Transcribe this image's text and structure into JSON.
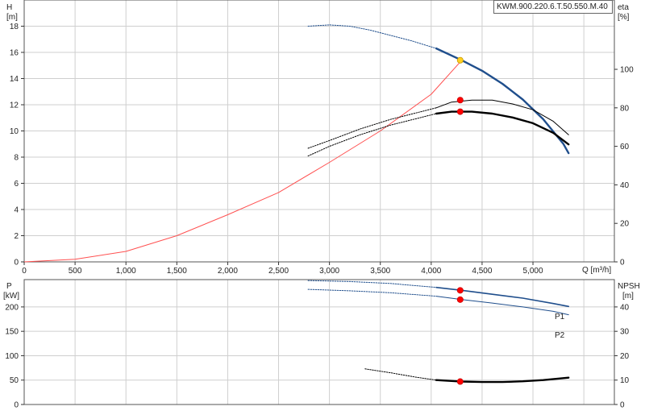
{
  "model": "KWM.900.220.6.T.50.550.M.40",
  "colors": {
    "curve_blue": "#1f4e8c",
    "system_red": "#ff5050",
    "black": "#000000",
    "op_point": "#ff0000",
    "op_yellow": "#ffd020"
  },
  "chart_data": [
    {
      "type": "line",
      "panel": "head_efficiency",
      "xlabel": "Q [m³/h]",
      "left_axis": {
        "label_top": "H",
        "label_unit": "[m]",
        "ticks": [
          "0",
          "2",
          "4",
          "6",
          "8",
          "10",
          "12",
          "14",
          "16",
          "18"
        ],
        "ylim": [
          0,
          20
        ]
      },
      "right_axis": {
        "label_top": "eta",
        "label_unit": "[%]",
        "ticks": [
          "0",
          "20",
          "40",
          "60",
          "80",
          "100"
        ],
        "ylim": [
          0,
          136
        ]
      },
      "x_ticks": [
        "0",
        "500",
        "1,000",
        "1,500",
        "2,000",
        "2,500",
        "3,000",
        "3,500",
        "4,000",
        "4,500",
        "5,000"
      ],
      "xlim": [
        0,
        5800
      ],
      "grid": true,
      "series": [
        {
          "id": "head_curve_dotted",
          "axis": "left",
          "style": "dotted",
          "color": "#1f4e8c",
          "x": [
            2790,
            3000,
            3200,
            3400,
            3600,
            3800,
            4050
          ],
          "y": [
            18.0,
            18.1,
            18.0,
            17.7,
            17.3,
            16.9,
            16.3
          ]
        },
        {
          "id": "head_curve",
          "axis": "left",
          "style": "solid-thick",
          "color": "#1f4e8c",
          "x": [
            4050,
            4300,
            4500,
            4700,
            4900,
            5100,
            5300,
            5350
          ],
          "y": [
            16.3,
            15.4,
            14.6,
            13.6,
            12.4,
            10.9,
            9.0,
            8.3
          ]
        },
        {
          "id": "system_curve",
          "axis": "left",
          "style": "solid-thin",
          "color": "#ff5050",
          "x": [
            0,
            500,
            1000,
            1500,
            2000,
            2500,
            3000,
            3500,
            4000,
            4300
          ],
          "y": [
            0,
            0.2,
            0.8,
            2.0,
            3.6,
            5.3,
            7.6,
            10.0,
            12.8,
            15.4
          ]
        },
        {
          "id": "eta_upper_dotted",
          "axis": "right",
          "style": "dotted",
          "color": "#000000",
          "x": [
            2790,
            3000,
            3300,
            3600,
            3900,
            4050
          ],
          "y": [
            59,
            63,
            69,
            74,
            78,
            80
          ]
        },
        {
          "id": "eta_upper",
          "axis": "right",
          "style": "solid-thin",
          "color": "#000000",
          "x": [
            4050,
            4200,
            4400,
            4600,
            4800,
            5000,
            5200,
            5350
          ],
          "y": [
            80,
            83,
            84,
            84,
            82,
            79,
            73,
            66
          ]
        },
        {
          "id": "eta_lower_dotted",
          "axis": "right",
          "style": "dotted",
          "color": "#000000",
          "x": [
            2790,
            3000,
            3300,
            3600,
            3900,
            4050
          ],
          "y": [
            55,
            60,
            66,
            71,
            75,
            77
          ]
        },
        {
          "id": "eta_lower",
          "axis": "right",
          "style": "solid-thick",
          "color": "#000000",
          "x": [
            4050,
            4200,
            4400,
            4600,
            4800,
            5000,
            5200,
            5350
          ],
          "y": [
            77,
            78,
            78,
            77,
            75,
            72,
            67,
            61
          ]
        }
      ],
      "points": [
        {
          "x": 4285,
          "y": 15.4,
          "axis": "left",
          "color": "#ffd020"
        },
        {
          "x": 4285,
          "y": 84,
          "axis": "right",
          "color": "#ff0000"
        },
        {
          "x": 4285,
          "y": 78,
          "axis": "right",
          "color": "#ff0000"
        }
      ]
    },
    {
      "type": "line",
      "panel": "power_npsh",
      "left_axis": {
        "label_top": "P",
        "label_unit": "[kW]",
        "ticks": [
          "0",
          "50",
          "100",
          "150",
          "200"
        ],
        "ylim": [
          0,
          256
        ]
      },
      "right_axis": {
        "label_top": "NPSH",
        "label_unit": "[m]",
        "ticks": [
          "0",
          "10",
          "20",
          "30",
          "40"
        ],
        "ylim": [
          0,
          51.2
        ]
      },
      "xlim": [
        0,
        5800
      ],
      "grid": true,
      "series": [
        {
          "id": "p1_dotted",
          "axis": "left",
          "style": "dotted",
          "color": "#1f4e8c",
          "x": [
            2790,
            3200,
            3600,
            4050
          ],
          "y": [
            254,
            252,
            248,
            240
          ]
        },
        {
          "id": "p1",
          "name": "P1",
          "axis": "left",
          "style": "solid-medium",
          "color": "#1f4e8c",
          "x": [
            4050,
            4300,
            4600,
            4900,
            5200,
            5350
          ],
          "y": [
            240,
            234,
            226,
            218,
            207,
            201
          ]
        },
        {
          "id": "p2_dotted",
          "axis": "left",
          "style": "dotted",
          "color": "#1f4e8c",
          "x": [
            2790,
            3200,
            3600,
            4050
          ],
          "y": [
            236,
            233,
            229,
            222
          ]
        },
        {
          "id": "p2",
          "name": "P2",
          "axis": "left",
          "style": "solid-thin",
          "color": "#1f4e8c",
          "x": [
            4050,
            4300,
            4600,
            4900,
            5200,
            5350
          ],
          "y": [
            222,
            215,
            208,
            200,
            191,
            184
          ]
        },
        {
          "id": "npsh_dotted",
          "axis": "right",
          "style": "dotted",
          "color": "#000000",
          "x": [
            3350,
            3600,
            3850,
            4050
          ],
          "y": [
            14.6,
            13.0,
            11.2,
            10.0
          ]
        },
        {
          "id": "npsh",
          "axis": "right",
          "style": "solid-thick",
          "color": "#000000",
          "x": [
            4050,
            4300,
            4500,
            4700,
            4900,
            5100,
            5350
          ],
          "y": [
            10.0,
            9.4,
            9.2,
            9.2,
            9.5,
            10.0,
            11.0
          ]
        }
      ],
      "points": [
        {
          "x": 4285,
          "y": 234,
          "axis": "left",
          "color": "#ff0000"
        },
        {
          "x": 4285,
          "y": 215,
          "axis": "left",
          "color": "#ff0000"
        },
        {
          "x": 4285,
          "y": 9.4,
          "axis": "right",
          "color": "#ff0000"
        }
      ]
    }
  ]
}
